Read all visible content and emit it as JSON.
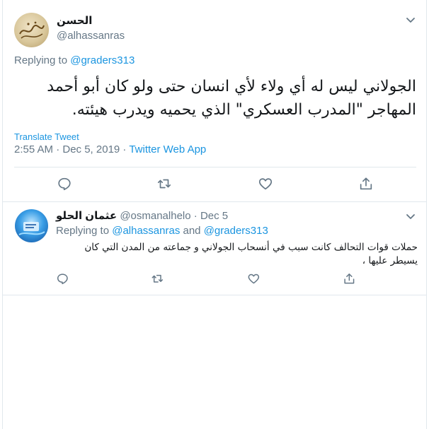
{
  "tweet": {
    "display_name": "الحسن",
    "handle": "@alhassanras",
    "replying_prefix": "Replying to",
    "replying_to": "@graders313",
    "text_line1": "الجولاني ليس له أي ولاء لأي انسان حتى ولو كان أبو أحمد",
    "text_line2": "المهاجر \"المدرب العسكري\" الذي يحميه ويدرب هيئته.",
    "translate_label": "Translate Tweet",
    "timestamp": "2:55 AM · Dec 5, 2019",
    "separator": " · ",
    "source": "Twitter Web App"
  },
  "reply": {
    "display_name": "عثمان الحلو",
    "handle": "@osmanalhelo",
    "date": "· Dec 5",
    "replying_prefix": "Replying to",
    "replying_to_1": "@alhassanras",
    "and_word": "and",
    "replying_to_2": "@graders313",
    "text_line1": "حملات قوات التحالف كانت سبب في أنسحاب الجولاني و جماعته من المدن التي كان",
    "text_line2": "يسيطر عليها ،"
  },
  "colors": {
    "accent": "#1b95e0",
    "muted": "#657786",
    "text": "#14171a",
    "divider": "#e1e8ed"
  },
  "icons": [
    "chevron-down-icon",
    "reply-icon",
    "retweet-icon",
    "like-icon",
    "share-icon"
  ]
}
